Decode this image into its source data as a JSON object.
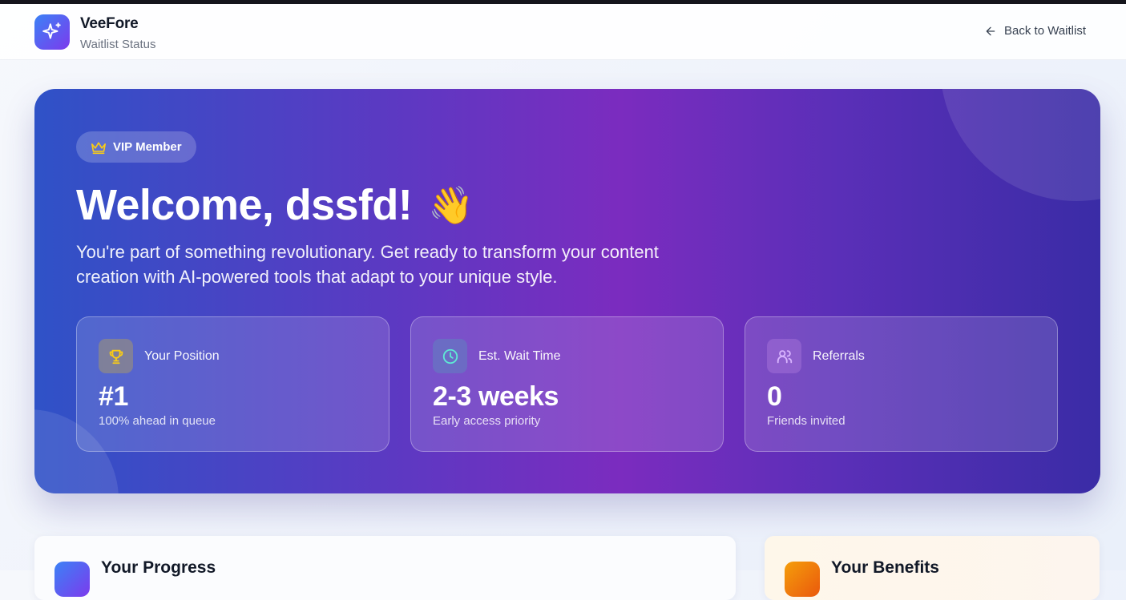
{
  "header": {
    "brand_name": "VeeFore",
    "brand_sub": "Waitlist Status",
    "back_label": "Back to Waitlist",
    "logo_icon": "sparkles-icon",
    "back_icon": "arrow-left-icon"
  },
  "hero": {
    "badge_label": "VIP Member",
    "badge_icon": "crown-icon",
    "title": "Welcome, dssfd!",
    "wave_emoji": "👋",
    "description": "You're part of something revolutionary. Get ready to transform your content creation with AI-powered tools that adapt to your unique style.",
    "stats": [
      {
        "icon": "trophy-icon",
        "label": "Your Position",
        "value": "#1",
        "sub": "100% ahead in queue"
      },
      {
        "icon": "clock-icon",
        "label": "Est. Wait Time",
        "value": "2-3 weeks",
        "sub": "Early access priority"
      },
      {
        "icon": "users-icon",
        "label": "Referrals",
        "value": "0",
        "sub": "Friends invited"
      }
    ]
  },
  "cards": {
    "progress_title": "Your Progress",
    "benefits_title": "Your Benefits"
  },
  "colors": {
    "hero_gradient_start": "#2f52c7",
    "hero_gradient_mid": "#7b2cbf",
    "hero_gradient_end": "#3a2ca6",
    "accent_gold": "#facc15",
    "accent_teal": "#5eead4",
    "accent_lilac": "#d8b4fe"
  }
}
